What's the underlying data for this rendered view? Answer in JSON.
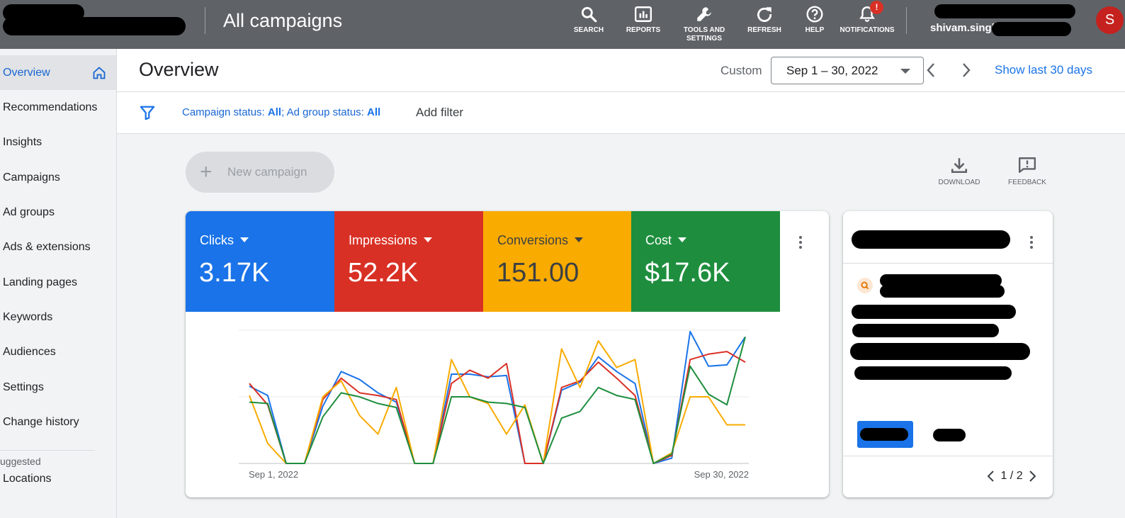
{
  "topbar": {
    "title": "All campaigns",
    "tools": [
      {
        "label": "SEARCH",
        "icon": "search-icon"
      },
      {
        "label": "REPORTS",
        "icon": "reports-icon"
      },
      {
        "label": "TOOLS AND SETTINGS",
        "icon": "wrench-icon"
      },
      {
        "label": "REFRESH",
        "icon": "refresh-icon"
      },
      {
        "label": "HELP",
        "icon": "help-icon"
      },
      {
        "label": "NOTIFICATIONS",
        "icon": "bell-icon"
      }
    ],
    "notification_badge": "!",
    "user_email": "shivam.singh@",
    "avatar_letter": "S"
  },
  "sidebar": {
    "items": [
      {
        "label": "Overview"
      },
      {
        "label": "Recommendations"
      },
      {
        "label": "Insights"
      },
      {
        "label": "Campaigns"
      },
      {
        "label": "Ad groups"
      },
      {
        "label": "Ads & extensions"
      },
      {
        "label": "Landing pages"
      },
      {
        "label": "Keywords"
      },
      {
        "label": "Audiences"
      },
      {
        "label": "Settings"
      },
      {
        "label": "Change history"
      }
    ],
    "section_label": "uggested",
    "suggested_items": [
      {
        "label": "Locations"
      }
    ]
  },
  "header": {
    "page_title": "Overview",
    "custom_label": "Custom",
    "date_range": "Sep 1 – 30, 2022",
    "show_last": "Show last 30 days"
  },
  "filters": {
    "campaign_status_label": "Campaign status: ",
    "campaign_status_value": "All",
    "separator": "; ",
    "adgroup_status_label": "Ad group status: ",
    "adgroup_status_value": "All",
    "add_filter": "Add filter"
  },
  "actions": {
    "new_campaign": "New campaign",
    "download": "DOWNLOAD",
    "feedback": "FEEDBACK"
  },
  "metrics": [
    {
      "label": "Clicks",
      "value": "3.17K",
      "color": "#1a73e8"
    },
    {
      "label": "Impressions",
      "value": "52.2K",
      "color": "#d93025"
    },
    {
      "label": "Conversions",
      "value": "151.00",
      "color": "#f9ab00"
    },
    {
      "label": "Cost",
      "value": "$17.6K",
      "color": "#1e8e3e"
    }
  ],
  "chart_data": {
    "type": "line",
    "x_start_label": "Sep 1, 2022",
    "x_end_label": "Sep 30, 2022",
    "ylim": [
      0,
      1
    ],
    "grid": true,
    "series": [
      {
        "color": "#1a73e8",
        "values": [
          0.58,
          0.51,
          0.0,
          0.0,
          0.43,
          0.69,
          0.63,
          0.53,
          0.46,
          0.0,
          0.0,
          0.67,
          0.67,
          0.65,
          0.66,
          0.0,
          0.0,
          0.55,
          0.61,
          0.8,
          0.69,
          0.6,
          0.0,
          0.04,
          0.99,
          0.73,
          0.74,
          0.95
        ]
      },
      {
        "color": "#d93025",
        "values": [
          0.6,
          0.44,
          0.0,
          0.0,
          0.48,
          0.64,
          0.53,
          0.51,
          0.48,
          0.0,
          0.0,
          0.6,
          0.7,
          0.64,
          0.75,
          0.0,
          0.0,
          0.57,
          0.62,
          0.76,
          0.64,
          0.51,
          0.0,
          0.06,
          0.78,
          0.82,
          0.84,
          0.76
        ]
      },
      {
        "color": "#f9ab00",
        "values": [
          0.51,
          0.15,
          0.0,
          0.0,
          0.5,
          0.62,
          0.36,
          0.22,
          0.57,
          0.0,
          0.0,
          0.78,
          0.5,
          0.45,
          0.22,
          0.44,
          0.0,
          0.86,
          0.57,
          0.92,
          0.72,
          0.78,
          0.0,
          0.08,
          0.5,
          0.5,
          0.29,
          0.29
        ]
      },
      {
        "color": "#1e8e3e",
        "values": [
          0.46,
          0.45,
          0.0,
          0.0,
          0.35,
          0.53,
          0.5,
          0.45,
          0.42,
          0.0,
          0.0,
          0.5,
          0.5,
          0.46,
          0.45,
          0.42,
          0.0,
          0.34,
          0.39,
          0.57,
          0.51,
          0.48,
          0.0,
          0.07,
          0.73,
          0.52,
          0.44,
          0.95
        ]
      }
    ]
  },
  "side_card": {
    "pager": "1 / 2"
  }
}
